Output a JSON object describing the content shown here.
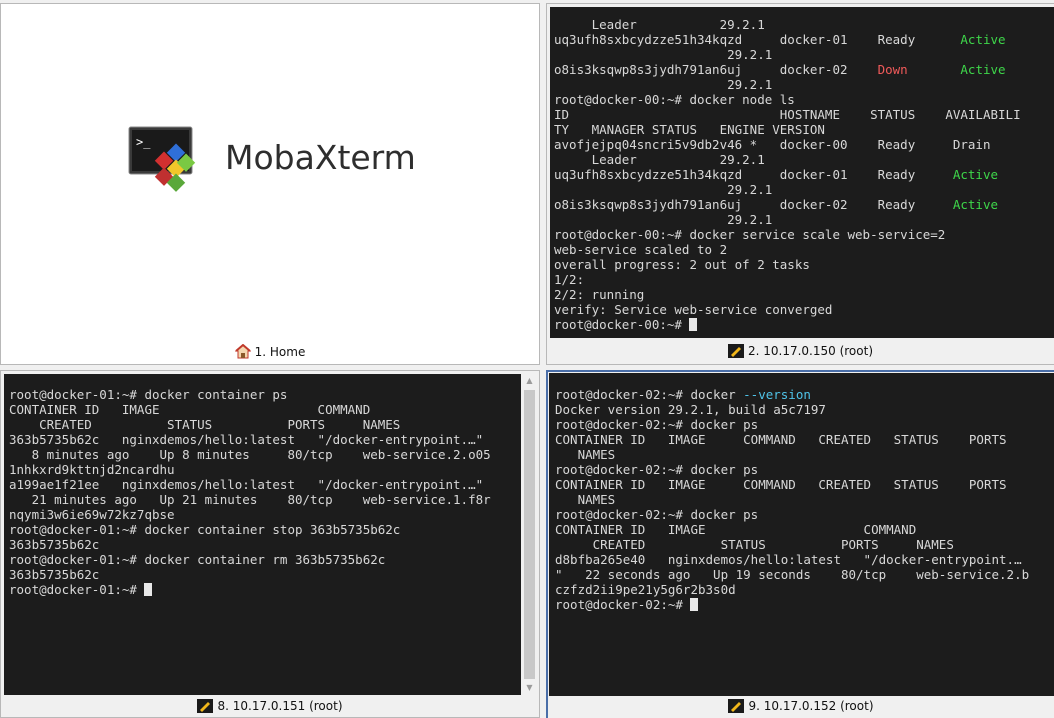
{
  "home": {
    "app_name": "MobaXterm",
    "tab_label": "1. Home"
  },
  "panes": [
    {
      "label": "2. 10.17.0.150 (root)",
      "lines": [
        [
          {
            "t": "     Leader           29.2.1"
          }
        ],
        [
          {
            "t": "uq3ufh8sxbcydzze51h34kqzd     docker-01    Ready      "
          },
          {
            "t": "Active",
            "c": "green"
          }
        ],
        [
          {
            "t": "                       29.2.1"
          }
        ],
        [
          {
            "t": "o8is3ksqwp8s3jydh791an6uj     docker-02    "
          },
          {
            "t": "Down",
            "c": "red"
          },
          {
            "t": "       "
          },
          {
            "t": "Active",
            "c": "green"
          }
        ],
        [
          {
            "t": "                       29.2.1"
          }
        ],
        [
          {
            "t": "root@docker-00:~# docker node ls"
          }
        ],
        [
          {
            "t": "ID                            HOSTNAME    STATUS    AVAILABILI"
          }
        ],
        [
          {
            "t": "TY   MANAGER STATUS   ENGINE VERSION"
          }
        ],
        [
          {
            "t": "avofjejpq04sncri5v9db2v46 *   docker-00    Ready     Drain"
          }
        ],
        [
          {
            "t": "     Leader           29.2.1"
          }
        ],
        [
          {
            "t": "uq3ufh8sxbcydzze51h34kqzd     docker-01    Ready     "
          },
          {
            "t": "Active",
            "c": "green"
          }
        ],
        [
          {
            "t": "                       29.2.1"
          }
        ],
        [
          {
            "t": "o8is3ksqwp8s3jydh791an6uj     docker-02    Ready     "
          },
          {
            "t": "Active",
            "c": "green"
          }
        ],
        [
          {
            "t": "                       29.2.1"
          }
        ],
        [
          {
            "t": "root@docker-00:~# docker service scale web-service=2"
          }
        ],
        [
          {
            "t": "web-service scaled to 2"
          }
        ],
        [
          {
            "t": "overall progress: 2 out of 2 tasks"
          }
        ],
        [
          {
            "t": "1/2:"
          }
        ],
        [
          {
            "t": "2/2: running"
          }
        ],
        [
          {
            "t": "verify: Service web-service converged"
          }
        ],
        [
          {
            "t": "root@docker-00:~# "
          },
          {
            "cursor": true
          }
        ]
      ]
    },
    {
      "label": "8. 10.17.0.151 (root)",
      "lines": [
        [
          {
            "t": "root@docker-01:~# docker container ps"
          }
        ],
        [
          {
            "t": "CONTAINER ID   IMAGE                     COMMAND"
          }
        ],
        [
          {
            "t": "    CREATED          STATUS          PORTS     NAMES"
          }
        ],
        [
          {
            "t": "363b5735b62c   nginxdemos/hello:latest   \"/docker-entrypoint.…\""
          }
        ],
        [
          {
            "t": "   8 minutes ago    Up 8 minutes     80/tcp    web-service.2.o05"
          }
        ],
        [
          {
            "t": "1nhkxrd9kttnjd2ncardhu"
          }
        ],
        [
          {
            "t": "a199ae1f21ee   nginxdemos/hello:latest   \"/docker-entrypoint.…\""
          }
        ],
        [
          {
            "t": "   21 minutes ago   Up 21 minutes    80/tcp    web-service.1.f8r"
          }
        ],
        [
          {
            "t": "nqymi3w6ie69w72kz7qbse"
          }
        ],
        [
          {
            "t": "root@docker-01:~# docker container stop 363b5735b62c"
          }
        ],
        [
          {
            "t": "363b5735b62c"
          }
        ],
        [
          {
            "t": "root@docker-01:~# docker container rm 363b5735b62c"
          }
        ],
        [
          {
            "t": "363b5735b62c"
          }
        ],
        [
          {
            "t": "root@docker-01:~# "
          },
          {
            "cursor": true
          }
        ]
      ]
    },
    {
      "label": "9. 10.17.0.152 (root)",
      "lines": [
        [
          {
            "t": "root@docker-02:~# docker "
          },
          {
            "t": "--version",
            "c": "cyan"
          }
        ],
        [
          {
            "t": "Docker version 29.2.1, build a5c7197"
          }
        ],
        [
          {
            "t": "root@docker-02:~# docker ps"
          }
        ],
        [
          {
            "t": "CONTAINER ID   IMAGE     COMMAND   CREATED   STATUS    PORTS"
          }
        ],
        [
          {
            "t": "   NAMES"
          }
        ],
        [
          {
            "t": "root@docker-02:~# docker ps"
          }
        ],
        [
          {
            "t": "CONTAINER ID   IMAGE     COMMAND   CREATED   STATUS    PORTS"
          }
        ],
        [
          {
            "t": "   NAMES"
          }
        ],
        [
          {
            "t": "root@docker-02:~# docker ps"
          }
        ],
        [
          {
            "t": "CONTAINER ID   IMAGE                     COMMAND"
          }
        ],
        [
          {
            "t": "     CREATED          STATUS          PORTS     NAMES"
          }
        ],
        [
          {
            "t": "d8bfba265e40   nginxdemos/hello:latest   \"/docker-entrypoint.…"
          }
        ],
        [
          {
            "t": "\"   22 seconds ago   Up 19 seconds    80/tcp    web-service.2.b"
          }
        ],
        [
          {
            "t": "czfzd2ii9pe21y5g6r2b3s0d"
          }
        ],
        [
          {
            "t": "root@docker-02:~# "
          },
          {
            "cursor": true
          }
        ]
      ]
    }
  ],
  "colors": {
    "terminal_bg": "#1c1c1c",
    "terminal_fg": "#d8d8d8",
    "green": "#3ed64a",
    "red": "#f05a5a",
    "cyan": "#4fc3e8",
    "active_border": "#4a6ea8"
  }
}
